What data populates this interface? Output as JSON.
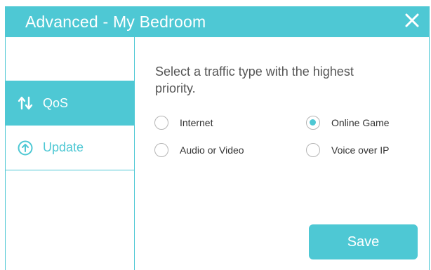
{
  "window": {
    "title": "Advanced - My Bedroom",
    "close_icon": "close-icon"
  },
  "sidebar": {
    "items": [
      {
        "label": "QoS",
        "icon": "qos-arrows-icon",
        "selected": true
      },
      {
        "label": "Update",
        "icon": "update-arrow-icon",
        "selected": false
      }
    ]
  },
  "main": {
    "prompt": "Select a traffic type with the highest priority.",
    "options": [
      {
        "label": "Internet",
        "checked": false
      },
      {
        "label": "Online Game",
        "checked": true
      },
      {
        "label": "Audio or Video",
        "checked": false
      },
      {
        "label": "Voice over IP",
        "checked": false
      }
    ],
    "save_label": "Save"
  },
  "colors": {
    "accent": "#4ec8d4",
    "text": "#555555",
    "radio_border": "#b5b5b5"
  }
}
